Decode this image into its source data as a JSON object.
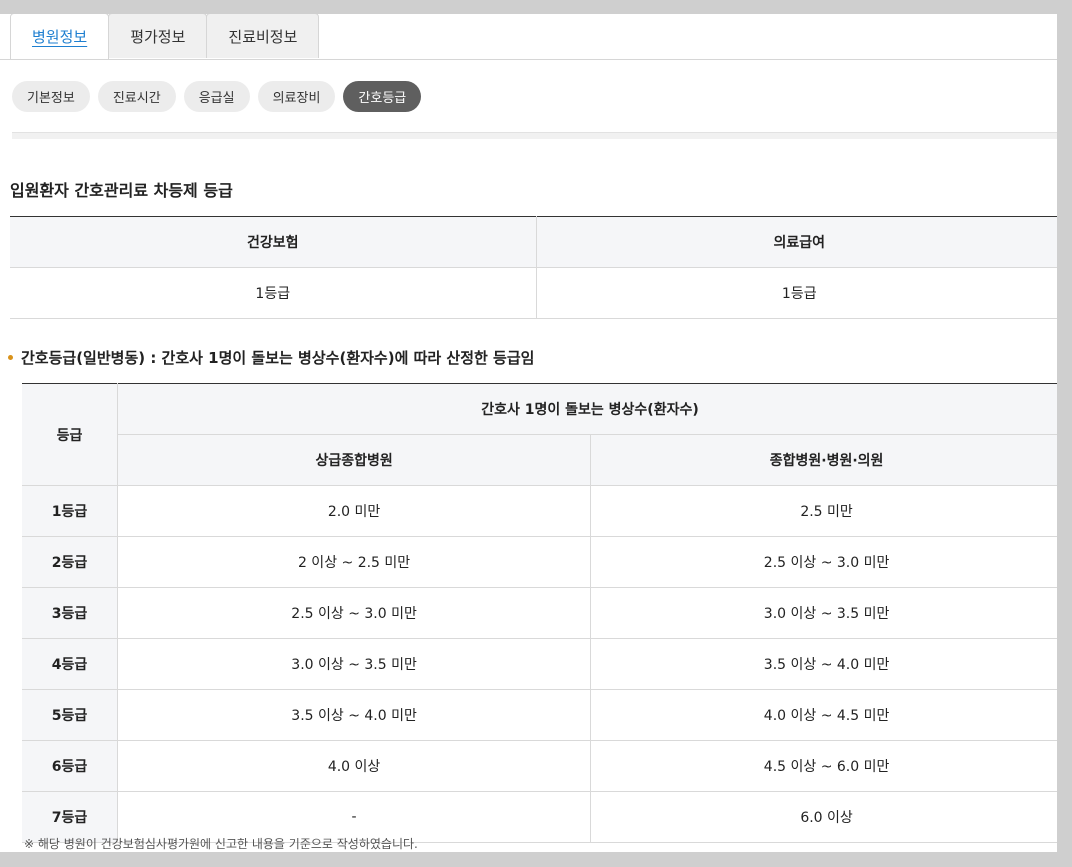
{
  "main_tabs": [
    {
      "label": "병원정보",
      "active": true
    },
    {
      "label": "평가정보",
      "active": false
    },
    {
      "label": "진료비정보",
      "active": false
    }
  ],
  "sub_tabs": [
    {
      "label": "기본정보",
      "active": false
    },
    {
      "label": "진료시간",
      "active": false
    },
    {
      "label": "응급실",
      "active": false
    },
    {
      "label": "의료장비",
      "active": false
    },
    {
      "label": "간호등급",
      "active": true
    }
  ],
  "section_title": "입원환자 간호관리료 차등제 등급",
  "grade_table": {
    "headers": [
      "건강보험",
      "의료급여"
    ],
    "values": [
      "1등급",
      "1등급"
    ]
  },
  "note": "간호등급(일반병동) : 간호사 1명이 돌보는 병상수(환자수)에 따라 산정한 등급임",
  "criteria_table": {
    "grade_header": "등급",
    "group_header": "간호사 1명이 돌보는 병상수(환자수)",
    "col_headers": [
      "상급종합병원",
      "종합병원·병원·의원"
    ],
    "rows": [
      {
        "grade": "1등급",
        "a": "2.0 미만",
        "b": "2.5 미만"
      },
      {
        "grade": "2등급",
        "a": "2 이상 ~ 2.5 미만",
        "b": "2.5 이상 ~ 3.0 미만"
      },
      {
        "grade": "3등급",
        "a": "2.5 이상 ~ 3.0 미만",
        "b": "3.0 이상 ~ 3.5 미만"
      },
      {
        "grade": "4등급",
        "a": "3.0 이상 ~ 3.5 미만",
        "b": "3.5 이상 ~ 4.0 미만"
      },
      {
        "grade": "5등급",
        "a": "3.5 이상 ~ 4.0 미만",
        "b": "4.0 이상 ~ 4.5 미만"
      },
      {
        "grade": "6등급",
        "a": "4.0 이상",
        "b": "4.5 이상 ~ 6.0 미만"
      },
      {
        "grade": "7등급",
        "a": "-",
        "b": "6.0 이상"
      }
    ]
  },
  "footnote": "※ 해당 병원이 건강보험심사평가원에 신고한 내용을 기준으로 작성하였습니다.",
  "colors": {
    "accent": "#1e7fd0",
    "bullet": "#d9921a",
    "active_pill": "#5f5f5f"
  }
}
